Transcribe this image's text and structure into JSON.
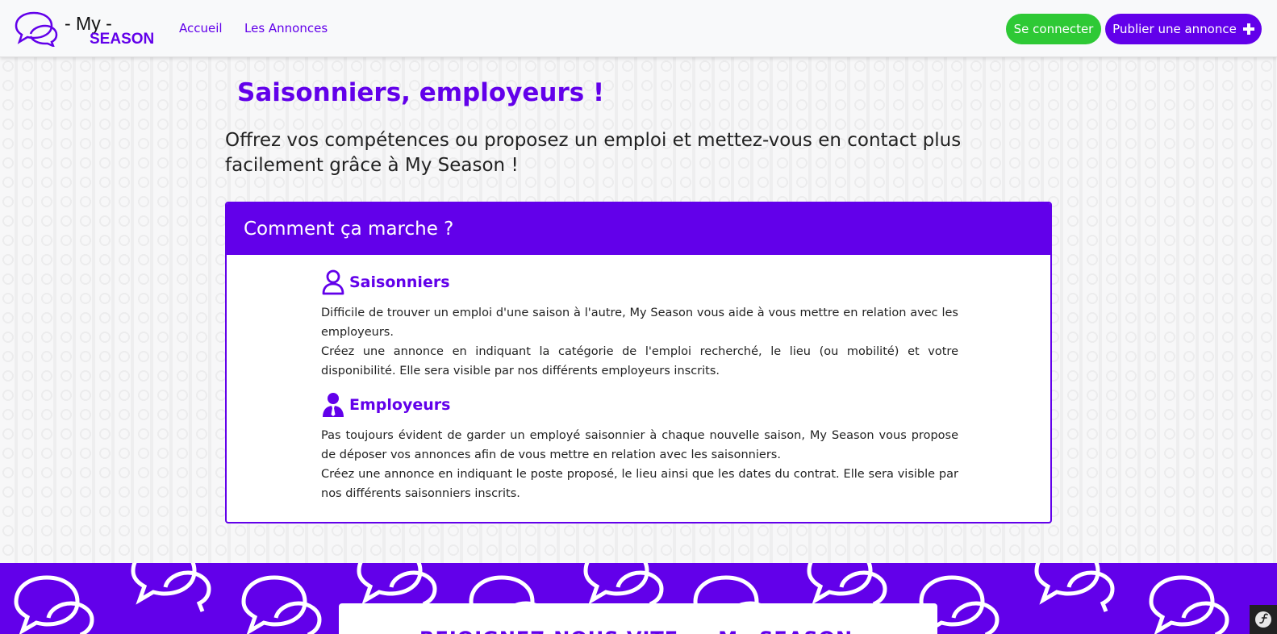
{
  "navbar": {
    "brand_my": "- My -",
    "brand_season": "SEASON",
    "links": {
      "accueil": "Accueil",
      "annonces": "Les Annonces"
    },
    "login_label": "Se connecter",
    "publish_label": "Publier une annonce",
    "publish_icon": "plus-icon"
  },
  "hero": {
    "title": "Saisonniers, employeurs !",
    "subtitle": "Offrez vos compétences ou proposez un emploi et mettez-vous en contact plus facilement grâce à My Season !"
  },
  "how_it_works": {
    "header": "Comment ça marche ?",
    "sections": [
      {
        "title": "Saisonniers",
        "icon": "user-outline-icon",
        "paragraph_1": "Difficile de trouver un emploi d'une saison à l'autre, My Season vous aide à vous mettre en relation avec les employeurs.",
        "paragraph_2": "Créez une annonce en indiquant la catégorie de l'emploi recherché, le lieu (ou mobilité) et votre disponibilité. Elle sera visible par nos différents employeurs inscrits."
      },
      {
        "title": "Employeurs",
        "icon": "user-tie-icon",
        "paragraph_1": "Pas toujours évident de garder un employé saisonnier à chaque nouvelle saison, My Season vous propose de déposer vos annonces afin de vous mettre en relation avec les saisonniers.",
        "paragraph_2": "Créez une annonce en indiquant le poste proposé, le lieu ainsi que les dates du contrat. Elle sera visible par nos différents saisonniers inscrits."
      }
    ]
  },
  "footer": {
    "newsletter_partial": "REJOIGNEZ-NOUS VITE ... My SEASON"
  },
  "colors": {
    "accent": "#6200ea",
    "success": "#2ec935"
  }
}
